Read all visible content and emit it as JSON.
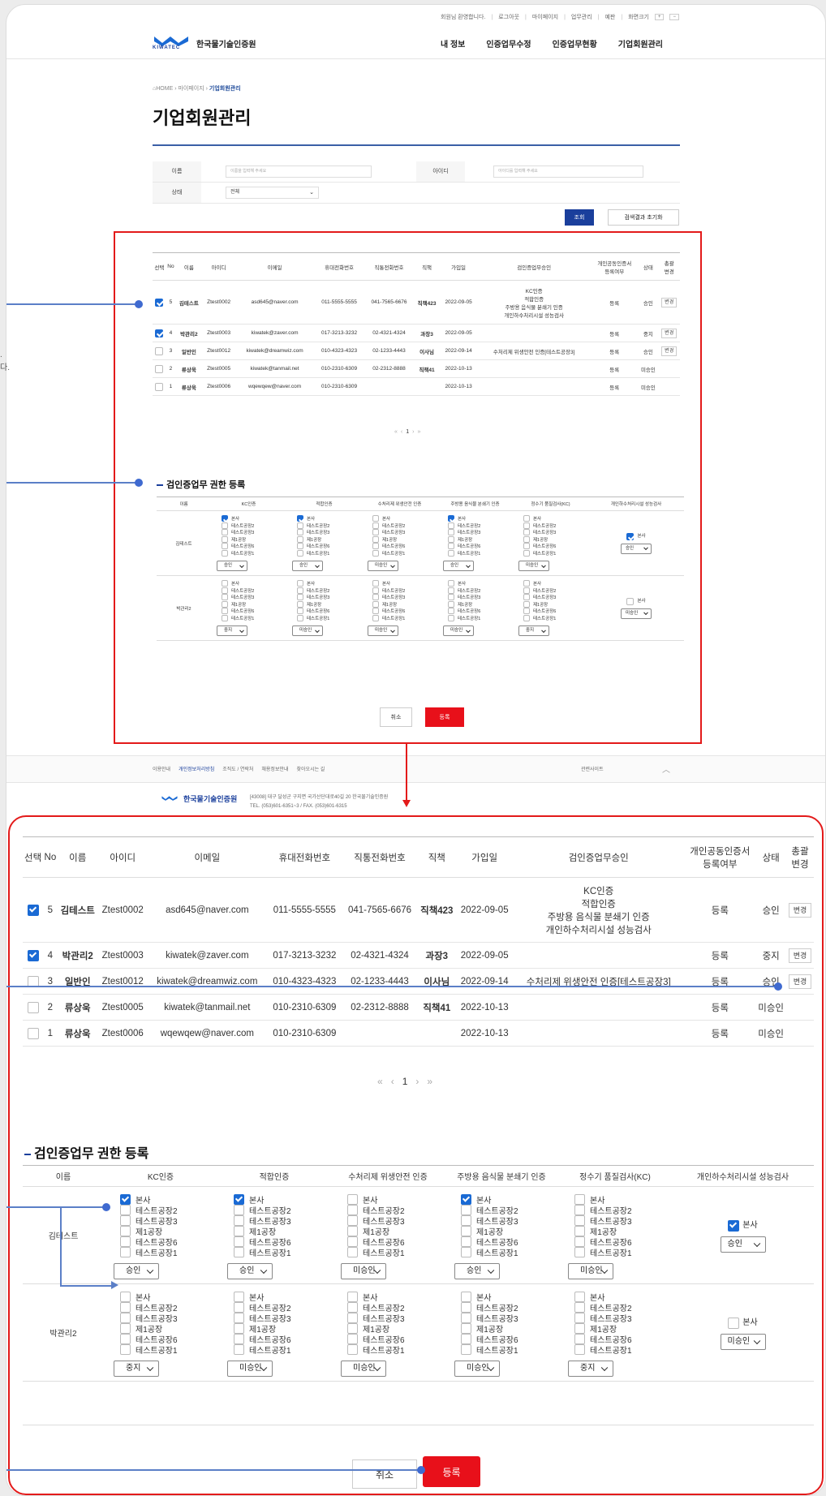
{
  "topbar": {
    "greeting": "회원님 환영합니다.",
    "links": [
      "로그아웃",
      "마이페이지",
      "업무관리",
      "예판",
      "화면크기"
    ],
    "size_plus": "+",
    "size_minus": "−"
  },
  "brand": {
    "logo_text": "KIWATEC",
    "name": "한국물기술인증원"
  },
  "gnb": [
    "내 정보",
    "인증업무수정",
    "인증업무현황",
    "기업회원관리"
  ],
  "breadcrumb": {
    "home": "HOME",
    "mid": "마이페이지",
    "current": "기업회원관리"
  },
  "page_title": "기업회원관리",
  "search": {
    "name_label": "이름",
    "name_placeholder": "이름을 입력해 주세요",
    "id_label": "아이디",
    "id_placeholder": "아이디를 입력해 주세요",
    "status_label": "상태",
    "status_value": "전체",
    "search_btn": "조회",
    "reset_btn": "검색결과 초기화"
  },
  "members": {
    "headers": [
      "선택",
      "No",
      "이름",
      "아이디",
      "이메일",
      "휴대전화번호",
      "직통전화번호",
      "직책",
      "가입일",
      "검인증업무승인",
      "개인공동인증서\n등록여부",
      "상태",
      "총괄\n변경"
    ],
    "rows": [
      {
        "checked": true,
        "no": "5",
        "name": "김테스트",
        "id": "Ztest0002",
        "email": "asd645@naver.com",
        "mobile": "011-5555-5555",
        "direct": "041-7565-6676",
        "pos": "직책423",
        "date": "2022-09-05",
        "approvals": [
          "KC인증",
          "적합인증",
          "주방용 음식물 분쇄기 인증",
          "개인하수처리시설 성능검사"
        ],
        "cert": "등록",
        "status": "승인",
        "change": "변경"
      },
      {
        "checked": true,
        "no": "4",
        "name": "박관리2",
        "id": "Ztest0003",
        "email": "kiwatek@zaver.com",
        "mobile": "017-3213-3232",
        "direct": "02-4321-4324",
        "pos": "과장3",
        "date": "2022-09-05",
        "approvals": [],
        "cert": "등록",
        "status": "중지",
        "change": "변경"
      },
      {
        "checked": false,
        "no": "3",
        "name": "일반인",
        "id": "Ztest0012",
        "email": "kiwatek@dreamwiz.com",
        "mobile": "010-4323-4323",
        "direct": "02-1233-4443",
        "pos": "이사님",
        "date": "2022-09-14",
        "approvals": [
          "수처리제 위생안전 인증[테스트공장3]"
        ],
        "cert": "등록",
        "status": "승인",
        "change": "변경"
      },
      {
        "checked": false,
        "no": "2",
        "name": "류상욱",
        "id": "Ztest0005",
        "email": "kiwatek@tanmail.net",
        "mobile": "010-2310-6309",
        "direct": "02-2312-8888",
        "pos": "직책41",
        "date": "2022-10-13",
        "approvals": [],
        "cert": "등록",
        "status": "미승인",
        "change": ""
      },
      {
        "checked": false,
        "no": "1",
        "name": "류상욱",
        "id": "Ztest0006",
        "email": "wqewqew@naver.com",
        "mobile": "010-2310-6309",
        "direct": "",
        "pos": "",
        "date": "2022-10-13",
        "approvals": [],
        "cert": "등록",
        "status": "미승인",
        "change": ""
      }
    ],
    "display_row2_email_small": "kiwatek@zaver.com"
  },
  "pager": {
    "first": "«",
    "prev": "‹",
    "current": "1",
    "next": "›",
    "last": "»"
  },
  "perm": {
    "title": "검인증업무 권한 등록",
    "headers": [
      "이름",
      "KC인증",
      "적합인증",
      "수처리제 위생안전 인증",
      "주방용 음식물 분쇄기 인증",
      "정수기 품질검사(KC)",
      "개인하수처리시설 성능검사"
    ],
    "factories": [
      "본사",
      "테스트공장2",
      "테스트공장3",
      "제1공장",
      "테스트공장6",
      "테스트공장1"
    ],
    "rows": [
      {
        "name": "김테스트",
        "checked": [
          [
            true,
            false,
            false,
            false,
            false,
            false
          ],
          [
            true,
            false,
            false,
            false,
            false,
            false
          ],
          [
            false,
            false,
            false,
            false,
            false,
            false
          ],
          [
            true,
            false,
            false,
            false,
            false,
            false
          ],
          [
            false,
            false,
            false,
            false,
            false,
            false
          ]
        ],
        "selects": [
          "승인",
          "승인",
          "미승인",
          "승인",
          "미승인"
        ],
        "sewage_checked": true,
        "sewage_label": "본사",
        "sewage_select": "승인"
      },
      {
        "name": "박관리2",
        "checked": [
          [
            false,
            false,
            false,
            false,
            false,
            false
          ],
          [
            false,
            false,
            false,
            false,
            false,
            false
          ],
          [
            false,
            false,
            false,
            false,
            false,
            false
          ],
          [
            false,
            false,
            false,
            false,
            false,
            false
          ],
          [
            false,
            false,
            false,
            false,
            false,
            false
          ]
        ],
        "selects": [
          "중지",
          "미승인",
          "미승인",
          "미승인",
          "중지"
        ],
        "sewage_checked": false,
        "sewage_label": "본사",
        "sewage_select": "미승인"
      }
    ],
    "cancel": "취소",
    "submit": "등록"
  },
  "footer": {
    "links": [
      "이용안내",
      "개인정보처리방침",
      "조직도 / 연락처",
      "채용정보안내",
      "찾아오시는 길"
    ],
    "related": "관련사이트",
    "brand": "한국물기술인증원",
    "address": "[43008] 대구 달성군 구지면 국가산단대로40길 20 한국물기술인증원",
    "tel": "TEL. (053)601-6351~3 / FAX. (053)601-6315"
  },
  "side_fragment": {
    "line1": ".",
    "line2": "다."
  },
  "colors": {
    "accent": "#1a3f9c",
    "danger": "#e31a1a",
    "check": "#1a6ad4",
    "callout": "#5b7fc7"
  }
}
